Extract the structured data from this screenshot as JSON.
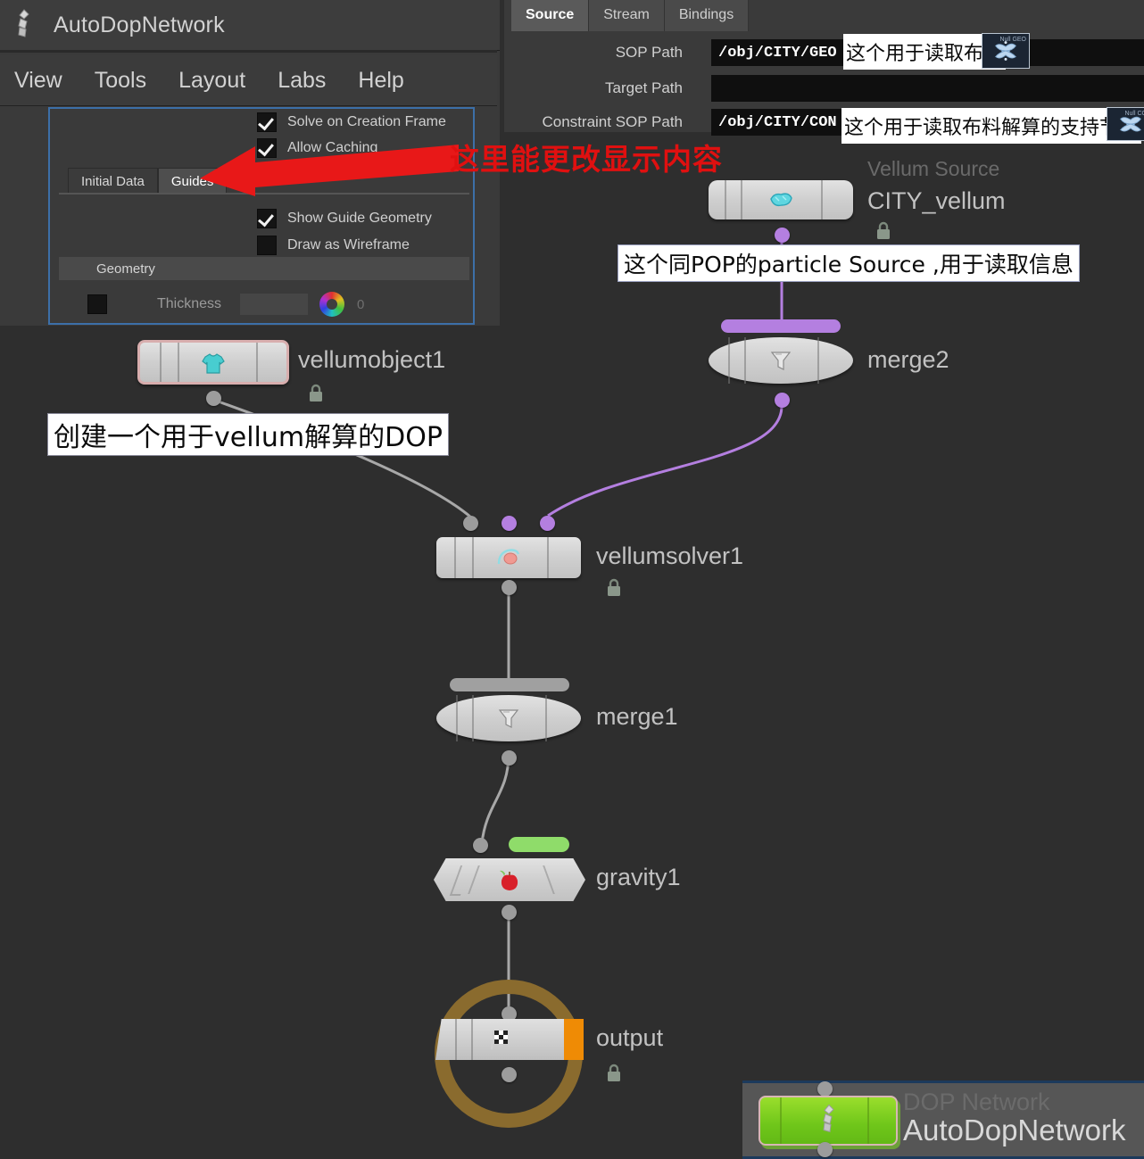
{
  "window": {
    "title": "AutoDopNetwork",
    "title_icon": "dop-network-icon",
    "menu": [
      "View",
      "Tools",
      "Layout",
      "Labs",
      "Help"
    ]
  },
  "param_panel": {
    "checkboxes": [
      {
        "label": "Solve on Creation Frame",
        "checked": true
      },
      {
        "label": "Allow Caching",
        "checked": true
      },
      {
        "label": "Show Guide Geometry",
        "checked": true
      },
      {
        "label": "Draw as Wireframe",
        "checked": false
      }
    ],
    "tabs": [
      {
        "label": "Initial Data",
        "active": false
      },
      {
        "label": "Guides",
        "active": true
      }
    ],
    "section_header": "Geometry",
    "thickness": {
      "label": "Thickness",
      "value": "0",
      "checked": false,
      "color_wheel_icon": "color-wheel-icon"
    }
  },
  "right_pane": {
    "tabs": [
      {
        "label": "Source",
        "active": true
      },
      {
        "label": "Stream",
        "active": false
      },
      {
        "label": "Bindings",
        "active": false
      }
    ],
    "rows": [
      {
        "label": "SOP Path",
        "value": "/obj/CITY/GEO",
        "thumb": "Null GEO"
      },
      {
        "label": "Target Path",
        "value": "",
        "thumb": ""
      },
      {
        "label": "Constraint SOP Path",
        "value": "/obj/CITY/CON",
        "thumb": "Null CON"
      }
    ]
  },
  "annotations": {
    "red_arrow_text": "这里能更改显示内容",
    "sop_path_note": "这个用于读取布料",
    "constraint_note": "这个用于读取布料解算的支持节点",
    "vellum_source_note": "这个同POP的particle Source ,用于读取信息",
    "vellumobject_note": "创建一个用于vellum解算的DOP"
  },
  "nodes": [
    {
      "id": "city_vellum",
      "name": "CITY_vellum",
      "type": "Vellum Source",
      "icon": "vellum-source-icon",
      "locked": true
    },
    {
      "id": "merge2",
      "name": "merge2",
      "type": "",
      "icon": "merge-funnel-icon",
      "locked": false
    },
    {
      "id": "vellumobject1",
      "name": "vellumobject1",
      "type": "",
      "icon": "vellum-tshirt-icon",
      "locked": true
    },
    {
      "id": "vellumsolver1",
      "name": "vellumsolver1",
      "type": "",
      "icon": "vellum-solver-icon",
      "locked": true
    },
    {
      "id": "merge1",
      "name": "merge1",
      "type": "",
      "icon": "merge-funnel-icon",
      "locked": false
    },
    {
      "id": "gravity1",
      "name": "gravity1",
      "type": "",
      "icon": "gravity-apple-icon",
      "locked": false
    },
    {
      "id": "output",
      "name": "output",
      "type": "",
      "icon": "checkered-flag-icon",
      "locked": true
    }
  ],
  "dop_strip": {
    "type": "DOP Network",
    "name": "AutoDopNetwork",
    "icon": "dop-network-icon"
  },
  "colors": {
    "background": "#2e2e2e",
    "panel": "#3a3a3a",
    "accent_blue": "#3c6fa8",
    "annotation_red": "#e01010",
    "wire_purple": "#b47fe0",
    "wire_grey": "#9c9c9c",
    "gravity_flag_green": "#8fdc6a",
    "output_ring": "#8a6b2e",
    "dop_node_green": "#7ecf1f"
  }
}
